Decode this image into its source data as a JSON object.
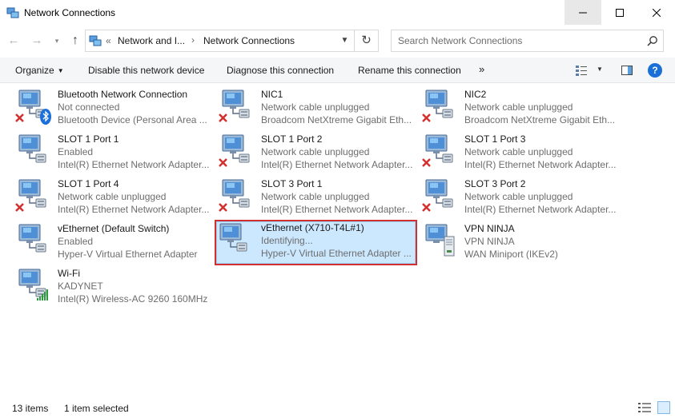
{
  "window": {
    "title": "Network Connections"
  },
  "address": {
    "crumb_sep": "«",
    "crumb1": "Network and I...",
    "crumb2": "Network Connections",
    "arrow": "›"
  },
  "search": {
    "placeholder": "Search Network Connections"
  },
  "toolbar": {
    "organize": "Organize",
    "disable": "Disable this network device",
    "diagnose": "Diagnose this connection",
    "rename": "Rename this connection",
    "more": "»",
    "help": "?"
  },
  "connections": [
    {
      "name": "Bluetooth Network Connection",
      "status": "Not connected",
      "device": "Bluetooth Device (Personal Area ...",
      "badge": "bluetooth"
    },
    {
      "name": "NIC1",
      "status": "Network cable unplugged",
      "device": "Broadcom NetXtreme Gigabit Eth...",
      "badge": "x"
    },
    {
      "name": "NIC2",
      "status": "Network cable unplugged",
      "device": "Broadcom NetXtreme Gigabit Eth...",
      "badge": "x"
    },
    {
      "name": "SLOT 1 Port 1",
      "status": "Enabled",
      "device": "Intel(R) Ethernet Network Adapter...",
      "badge": "none"
    },
    {
      "name": "SLOT 1 Port 2",
      "status": "Network cable unplugged",
      "device": "Intel(R) Ethernet Network Adapter...",
      "badge": "x"
    },
    {
      "name": "SLOT 1 Port 3",
      "status": "Network cable unplugged",
      "device": "Intel(R) Ethernet Network Adapter...",
      "badge": "x"
    },
    {
      "name": "SLOT 1 Port 4",
      "status": "Network cable unplugged",
      "device": "Intel(R) Ethernet Network Adapter...",
      "badge": "x"
    },
    {
      "name": "SLOT 3 Port 1",
      "status": "Network cable unplugged",
      "device": "Intel(R) Ethernet Network Adapter...",
      "badge": "x"
    },
    {
      "name": "SLOT 3 Port 2",
      "status": "Network cable unplugged",
      "device": "Intel(R) Ethernet Network Adapter...",
      "badge": "x"
    },
    {
      "name": "vEthernet (Default Switch)",
      "status": "Enabled",
      "device": "Hyper-V Virtual Ethernet Adapter",
      "badge": "none"
    },
    {
      "name": "vEthernet (X710-T4L#1)",
      "status": "Identifying...",
      "device": "Hyper-V Virtual Ethernet Adapter ...",
      "badge": "none",
      "selected": true
    },
    {
      "name": "VPN NINJA",
      "status": "VPN NINJA",
      "device": "WAN Miniport (IKEv2)",
      "badge": "vpn"
    },
    {
      "name": "Wi-Fi",
      "status": "KADYNET",
      "device": "Intel(R) Wireless-AC 9260 160MHz",
      "badge": "wifi"
    }
  ],
  "statusbar": {
    "count": "13 items",
    "selected": "1 item selected"
  },
  "colors": {
    "selection_bg": "#cce8ff",
    "selection_border": "#d32f2f",
    "error_x": "#d32f2f",
    "bluetooth": "#1a6fd8",
    "help": "#1a6fd8"
  }
}
